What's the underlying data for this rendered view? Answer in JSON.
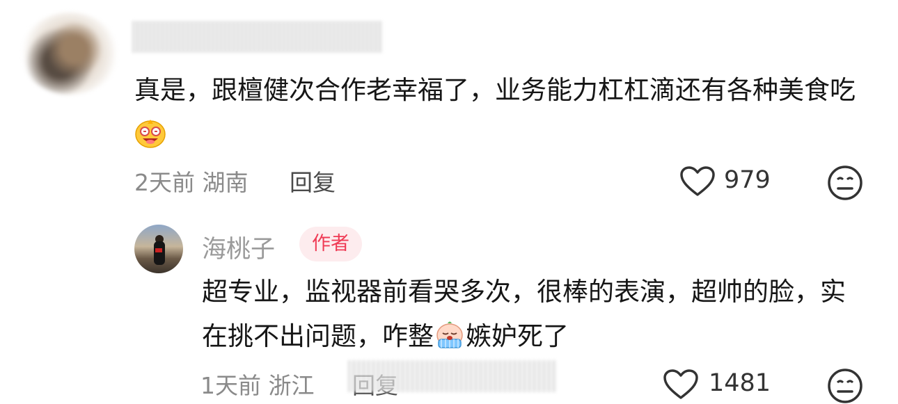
{
  "comment1": {
    "text_part1": "真是，跟檀健次合作老幸福了，业务能力杠杠滴还有各种美食吃",
    "meta": "2天前 湖南",
    "reply_label": "回复",
    "likes": "979"
  },
  "comment2": {
    "username": "海桃子",
    "badge": "作者",
    "text_part1": "超专业，监视器前看哭多次，很棒的表演，超帅的脸，实在挑不出问题，咋整",
    "text_part2": "嫉妒死了",
    "meta": "1天前 浙江",
    "reply_label": "回复",
    "likes": "1481"
  },
  "icons": {
    "heart": "heart-outline-icon",
    "face": "neutral-face-icon",
    "emoji1": "drooling-yummy-emoji",
    "emoji2": "crying-emoji"
  }
}
